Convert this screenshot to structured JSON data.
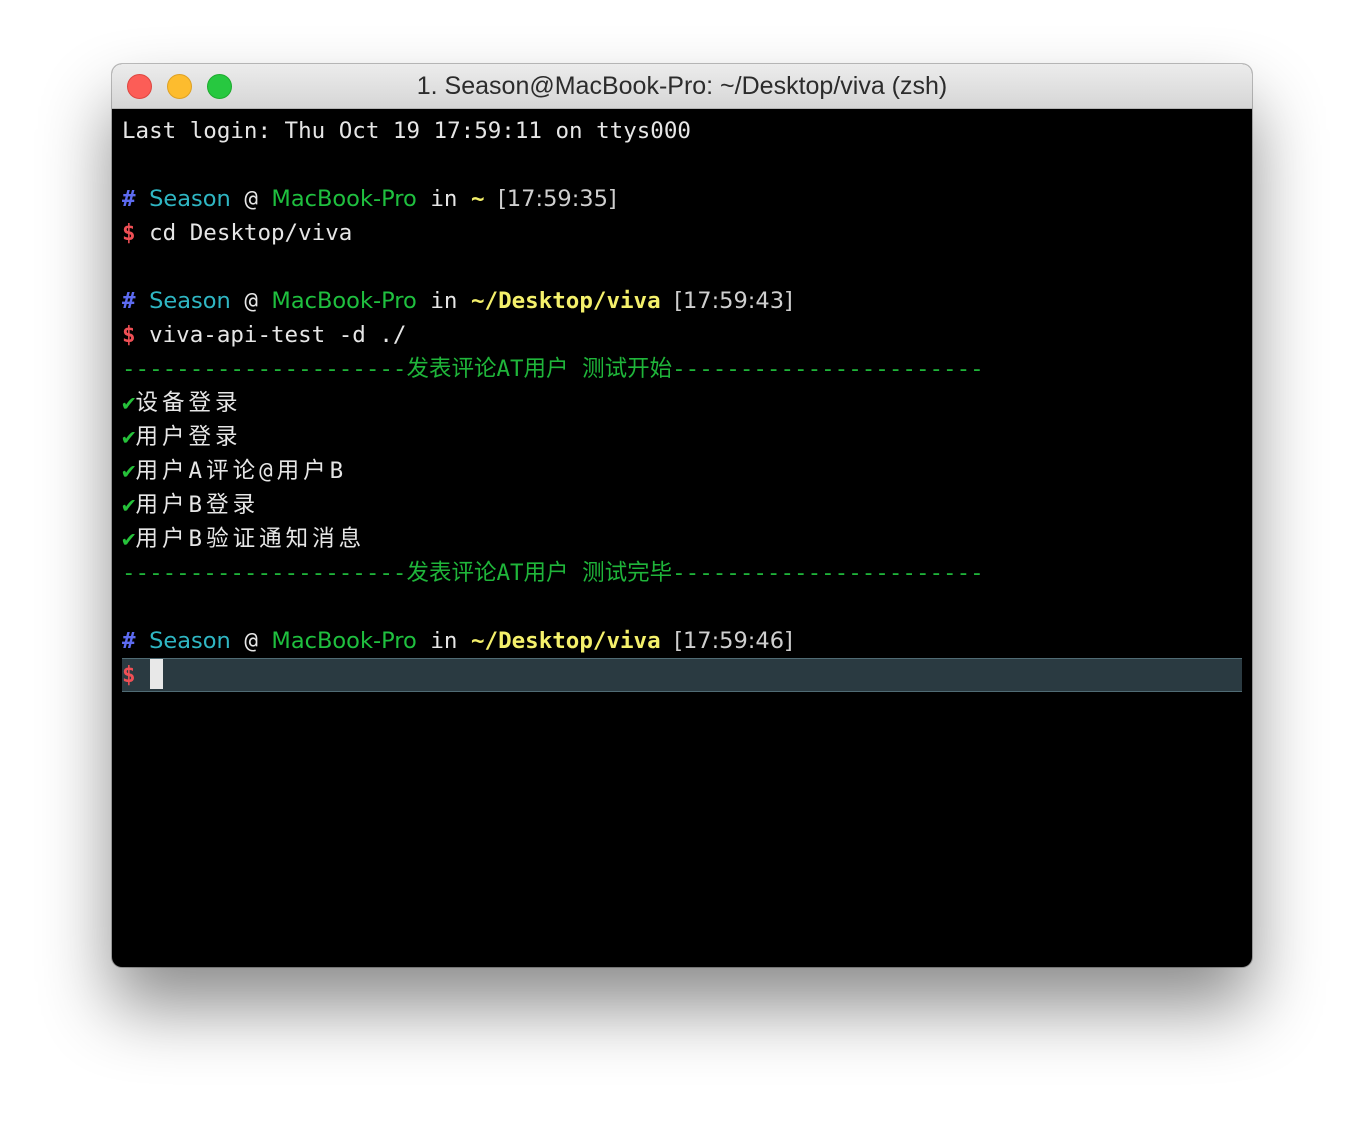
{
  "window": {
    "title": "1. Season@MacBook-Pro: ~/Desktop/viva (zsh)"
  },
  "terminal": {
    "last_login": "Last login: Thu Oct 19 17:59:11 on ttys000",
    "prompts": [
      {
        "hash": "#",
        "user": "Season",
        "at": "@",
        "host": "MacBook-Pro",
        "in": "in",
        "dir": "~",
        "time": "[17:59:35]",
        "dollar": "$",
        "command": "cd Desktop/viva"
      },
      {
        "hash": "#",
        "user": "Season",
        "at": "@",
        "host": "MacBook-Pro",
        "in": "in",
        "dir": "~/Desktop/viva",
        "time": "[17:59:43]",
        "dollar": "$",
        "command": "viva-api-test -d ./"
      },
      {
        "hash": "#",
        "user": "Season",
        "at": "@",
        "host": "MacBook-Pro",
        "in": "in",
        "dir": "~/Desktop/viva",
        "time": "[17:59:46]",
        "dollar": "$",
        "command": ""
      }
    ],
    "output": {
      "header": "---------------------发表评论AT用户 测试开始-----------------------",
      "check_mark": "✔",
      "items": [
        "设备登录",
        "用户登录",
        "用户A评论@用户B",
        "用户B登录",
        "用户B验证通知消息"
      ],
      "footer": "---------------------发表评论AT用户 测试完毕-----------------------"
    }
  }
}
